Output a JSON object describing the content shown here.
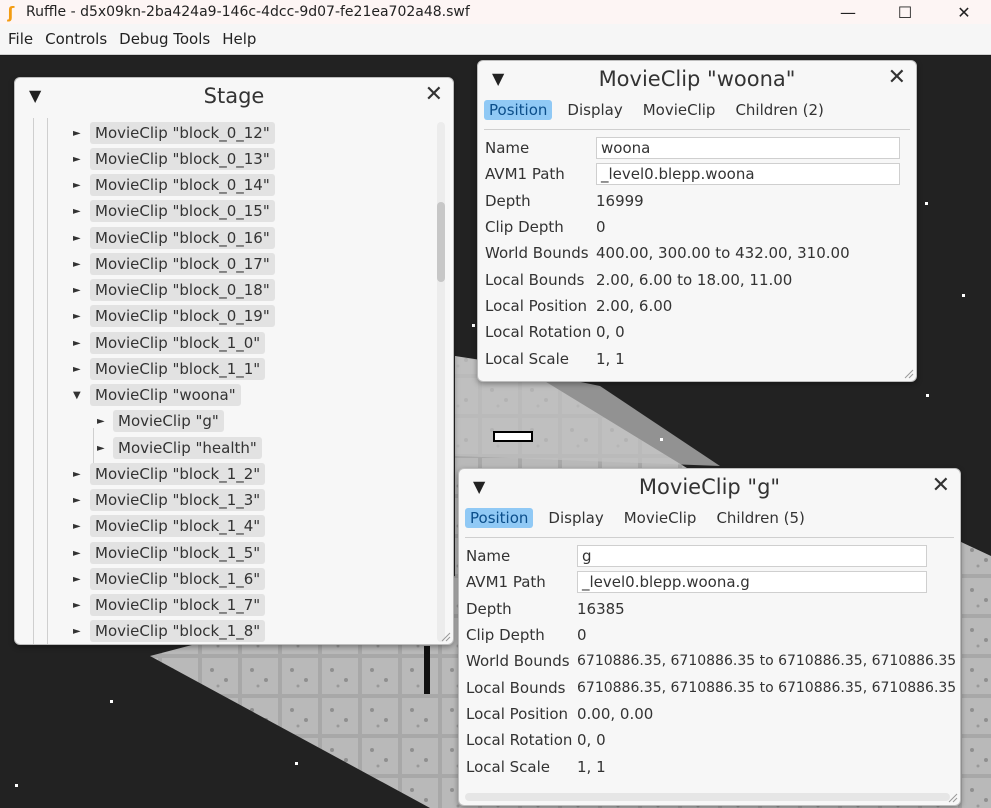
{
  "window": {
    "title": "Ruffle - d5x09kn-2ba424a9-146c-4dcc-9d07-fe21ea702a48.swf",
    "minimize": "—",
    "maximize": "☐",
    "close": "✕"
  },
  "menu": [
    "File",
    "Controls",
    "Debug Tools",
    "Help"
  ],
  "stage_window": {
    "title": "Stage",
    "collapse_icon": "▼",
    "close_icon": "✕",
    "items": [
      {
        "arrow": "►",
        "label": "MovieClip \"block_0_12\""
      },
      {
        "arrow": "►",
        "label": "MovieClip \"block_0_13\""
      },
      {
        "arrow": "►",
        "label": "MovieClip \"block_0_14\""
      },
      {
        "arrow": "►",
        "label": "MovieClip \"block_0_15\""
      },
      {
        "arrow": "►",
        "label": "MovieClip \"block_0_16\""
      },
      {
        "arrow": "►",
        "label": "MovieClip \"block_0_17\""
      },
      {
        "arrow": "►",
        "label": "MovieClip \"block_0_18\""
      },
      {
        "arrow": "►",
        "label": "MovieClip \"block_0_19\""
      },
      {
        "arrow": "►",
        "label": "MovieClip \"block_1_0\""
      },
      {
        "arrow": "►",
        "label": "MovieClip \"block_1_1\""
      },
      {
        "arrow": "▼",
        "label": "MovieClip \"woona\""
      },
      {
        "arrow": "►",
        "label": "MovieClip \"g\""
      },
      {
        "arrow": "►",
        "label": "MovieClip \"health\""
      },
      {
        "arrow": "►",
        "label": "MovieClip \"block_1_2\""
      },
      {
        "arrow": "►",
        "label": "MovieClip \"block_1_3\""
      },
      {
        "arrow": "►",
        "label": "MovieClip \"block_1_4\""
      },
      {
        "arrow": "►",
        "label": "MovieClip \"block_1_5\""
      },
      {
        "arrow": "►",
        "label": "MovieClip \"block_1_6\""
      },
      {
        "arrow": "►",
        "label": "MovieClip \"block_1_7\""
      },
      {
        "arrow": "►",
        "label": "MovieClip \"block_1_8\""
      }
    ]
  },
  "woona_window": {
    "title": "MovieClip \"woona\"",
    "collapse_icon": "▼",
    "close_icon": "✕",
    "tabs": [
      "Position",
      "Display",
      "MovieClip",
      "Children (2)"
    ],
    "active_tab": "Position",
    "props": {
      "name_label": "Name",
      "name_value": "woona",
      "path_label": "AVM1 Path",
      "path_value": "_level0.blepp.woona",
      "depth_label": "Depth",
      "depth_value": "16999",
      "clip_depth_label": "Clip Depth",
      "clip_depth_value": "0",
      "world_bounds_label": "World Bounds",
      "world_bounds_value": "400.00, 300.00 to 432.00, 310.00",
      "local_bounds_label": "Local Bounds",
      "local_bounds_value": "2.00, 6.00 to 18.00, 11.00",
      "local_position_label": "Local Position",
      "local_position_value": "2.00, 6.00",
      "local_rotation_label": "Local Rotation",
      "local_rotation_value": "0, 0",
      "local_scale_label": "Local Scale",
      "local_scale_value": "1, 1"
    }
  },
  "g_window": {
    "title": "MovieClip \"g\"",
    "collapse_icon": "▼",
    "close_icon": "✕",
    "tabs": [
      "Position",
      "Display",
      "MovieClip",
      "Children (5)"
    ],
    "active_tab": "Position",
    "props": {
      "name_label": "Name",
      "name_value": "g",
      "path_label": "AVM1 Path",
      "path_value": "_level0.blepp.woona.g",
      "depth_label": "Depth",
      "depth_value": "16385",
      "clip_depth_label": "Clip Depth",
      "clip_depth_value": "0",
      "world_bounds_label": "World Bounds",
      "world_bounds_value": "6710886.35, 6710886.35 to 6710886.35, 6710886.35",
      "local_bounds_label": "Local Bounds",
      "local_bounds_value": "6710886.35, 6710886.35 to 6710886.35, 6710886.35",
      "local_position_label": "Local Position",
      "local_position_value": "0.00, 0.00",
      "local_rotation_label": "Local Rotation",
      "local_rotation_value": "0, 0",
      "local_scale_label": "Local Scale",
      "local_scale_value": "1, 1"
    }
  },
  "colors": {
    "accent_tab": "#90c9f5",
    "app_icon": "#f39c12"
  }
}
